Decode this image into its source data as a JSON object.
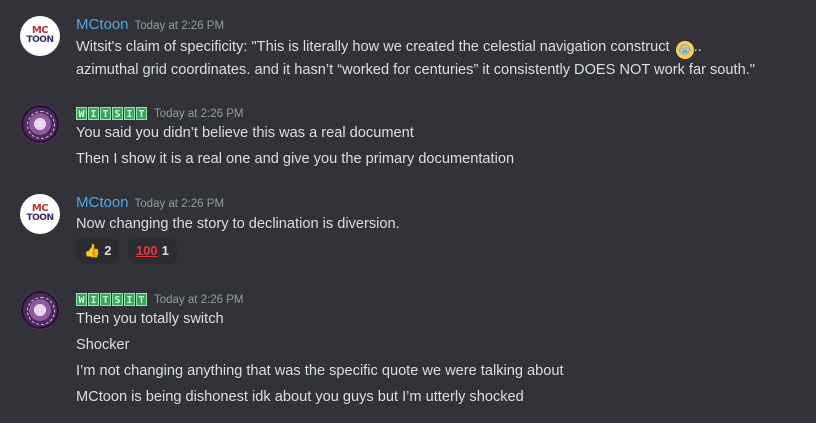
{
  "messages": [
    {
      "author": "MCtoon",
      "avatar_text1": "MC",
      "avatar_text2": "TOON",
      "timestamp": "Today at 2:26 PM",
      "lines": [
        "Witsit's claim of specificity: \"This is literally how we created the celestial navigation construct",
        "azimuthal grid coordinates. and it hasn’t “worked for centuries” it consistently DOES NOT work far south.\""
      ],
      "emoji": "crying-face",
      "after_emoji": ".."
    },
    {
      "author_letters": [
        "W",
        "I",
        "T",
        "S",
        "I",
        "T"
      ],
      "timestamp": "Today at 2:26 PM",
      "lines": [
        "You said you didn’t believe this was a real document",
        "Then I show it is a real one and give you the primary documentation"
      ]
    },
    {
      "author": "MCtoon",
      "avatar_text1": "MC",
      "avatar_text2": "TOON",
      "timestamp": "Today at 2:26 PM",
      "lines": [
        "Now changing the story to declination is diversion."
      ],
      "reactions": [
        {
          "icon": "thumbs-up-icon",
          "glyph": "👍",
          "count": "2"
        },
        {
          "icon": "hundred-points-icon",
          "glyph": "100",
          "count": "1"
        }
      ]
    },
    {
      "author_letters": [
        "W",
        "I",
        "T",
        "S",
        "I",
        "T"
      ],
      "timestamp": "Today at 2:26 PM",
      "lines": [
        "Then you totally switch",
        "Shocker",
        "I’m not changing anything that was the specific quote we were talking about",
        "MCtoon is being dishonest idk about you guys but I’m utterly shocked"
      ]
    }
  ],
  "colors": {
    "background": "#313338",
    "username_mctoon": "#4ea6e5",
    "timestamp": "#949ba4",
    "text": "#dbdee1"
  }
}
